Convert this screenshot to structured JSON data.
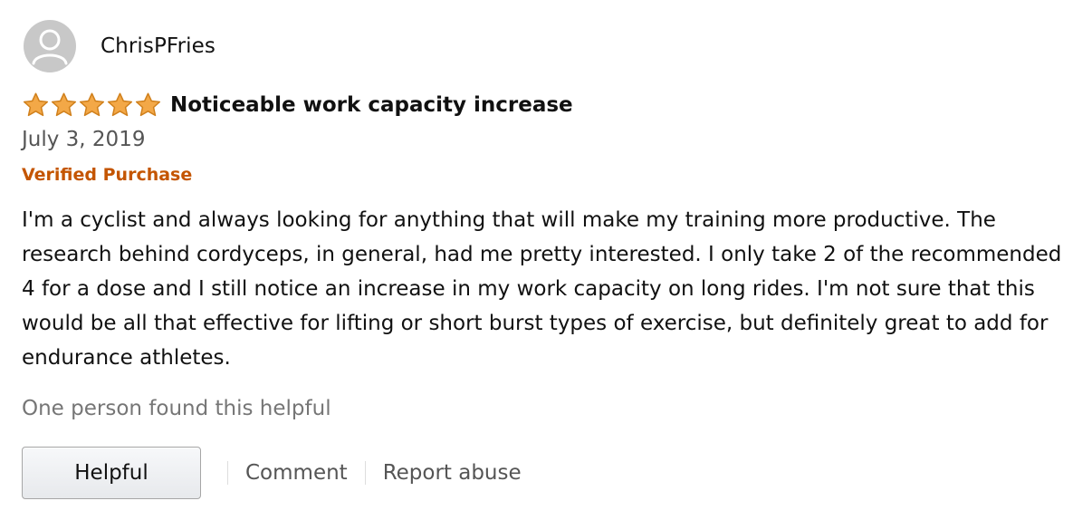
{
  "reviewer": {
    "name": "ChrisPFries",
    "avatar_icon": "user-silhouette-icon"
  },
  "rating": {
    "stars": 5,
    "max": 5,
    "star_color": "#f3a847"
  },
  "review": {
    "title": "Noticeable work capacity increase",
    "date": "July 3, 2019",
    "badge": "Verified Purchase",
    "badge_color": "#c45500",
    "body": "I'm a cyclist and always looking for anything that will make my training more productive. The research behind cordyceps, in general, had me pretty interested. I only take 2 of the recommended 4 for a dose and I still notice an increase in my work capacity on long rides. I'm not sure that this would be all that effective for lifting or short burst types of exercise, but definitely great to add for endurance athletes."
  },
  "helpful_count_text": "One person found this helpful",
  "actions": {
    "helpful_label": "Helpful",
    "comment_label": "Comment",
    "report_label": "Report abuse"
  }
}
